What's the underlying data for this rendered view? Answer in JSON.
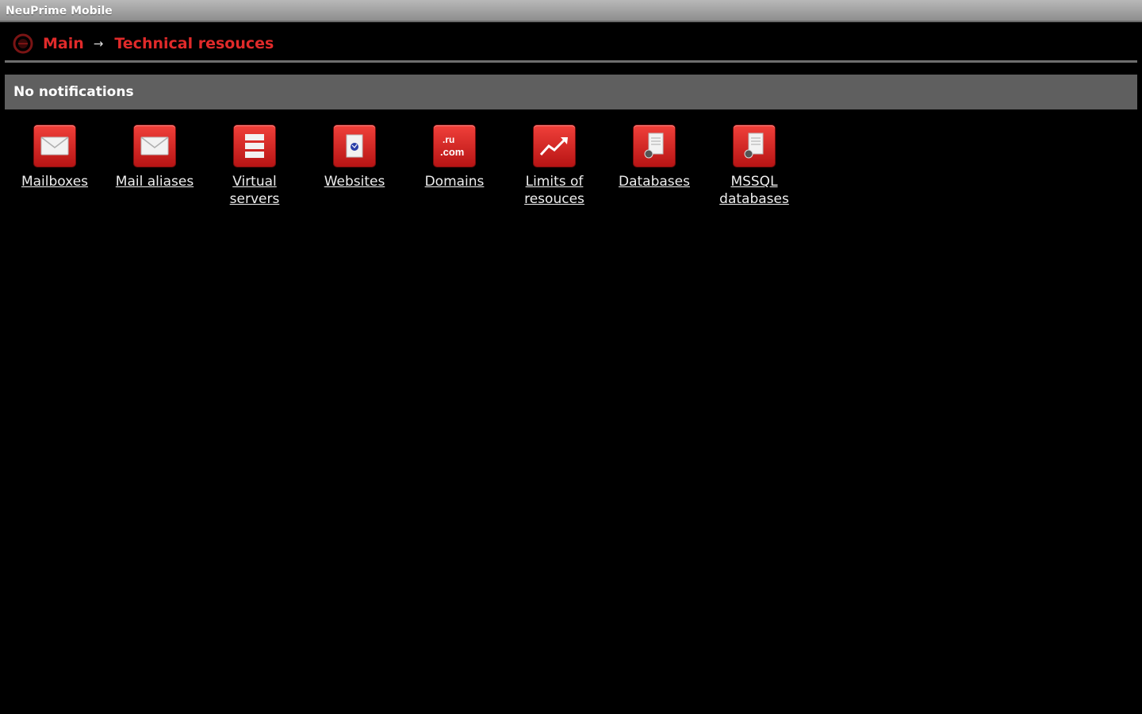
{
  "window": {
    "title": "NeuPrime Mobile"
  },
  "breadcrumb": {
    "home_icon": "home-circle-icon",
    "items": [
      {
        "label": "Main"
      },
      {
        "label": "Technical resouces"
      }
    ],
    "separator": "→"
  },
  "notifications": {
    "text": "No notifications"
  },
  "tiles": [
    {
      "label": "Mailboxes",
      "icon": "envelope-icon"
    },
    {
      "label": "Mail aliases",
      "icon": "envelope-icon"
    },
    {
      "label": "Virtual servers",
      "icon": "server-icon"
    },
    {
      "label": "Websites",
      "icon": "web-page-icon"
    },
    {
      "label": "Domains",
      "icon": "domain-icon",
      "icon_text": [
        ".ru",
        ".com"
      ]
    },
    {
      "label": "Limits of resouces",
      "icon": "trend-chart-icon"
    },
    {
      "label": "Databases",
      "icon": "database-doc-icon"
    },
    {
      "label": "MSSQL databases",
      "icon": "database-doc-icon"
    }
  ],
  "colors": {
    "accent": "#e02a2a",
    "tile": "#d42a28",
    "notification_bar": "#5f5f5f",
    "background": "#000000"
  }
}
